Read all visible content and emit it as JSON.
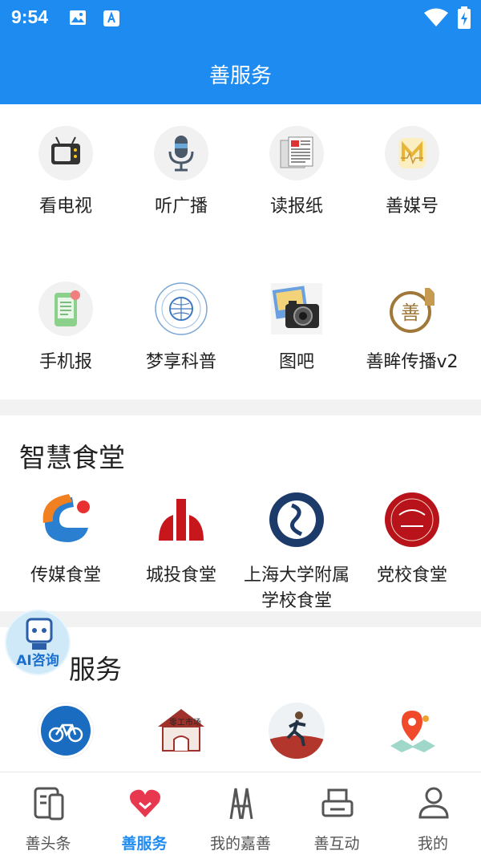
{
  "status": {
    "time": "9:54"
  },
  "header": {
    "title": "善服务"
  },
  "media_grid": [
    {
      "label": "看电视",
      "icon": "tv-icon"
    },
    {
      "label": "听广播",
      "icon": "microphone-icon"
    },
    {
      "label": "读报纸",
      "icon": "newspaper-icon"
    },
    {
      "label": "善媒号",
      "icon": "media-account-icon"
    },
    {
      "label": "手机报",
      "icon": "mobile-news-icon"
    },
    {
      "label": "梦享科普",
      "icon": "science-popularization-icon"
    },
    {
      "label": "图吧",
      "icon": "camera-photo-icon"
    },
    {
      "label": "善眸传播v2",
      "icon": "shanmou-icon"
    }
  ],
  "canteen": {
    "title": "智慧食堂",
    "items": [
      {
        "label": "传媒食堂",
        "icon": "media-canteen-logo"
      },
      {
        "label": "城投食堂",
        "icon": "chengtou-logo"
      },
      {
        "label": "上海大学附属学校食堂",
        "icon": "shu-school-logo"
      },
      {
        "label": "党校食堂",
        "icon": "party-school-logo"
      }
    ]
  },
  "services": {
    "title": "生活服务",
    "items": [
      {
        "icon": "bicycle-icon"
      },
      {
        "icon": "market-icon"
      },
      {
        "icon": "runner-icon"
      },
      {
        "icon": "map-pin-icon"
      }
    ]
  },
  "ai": {
    "label": "AI咨询"
  },
  "tabbar": [
    {
      "label": "善头条",
      "icon": "news-icon",
      "active": false
    },
    {
      "label": "善服务",
      "icon": "heart-icon",
      "active": true
    },
    {
      "label": "我的嘉善",
      "icon": "bridge-icon",
      "active": false
    },
    {
      "label": "善互动",
      "icon": "printer-icon",
      "active": false
    },
    {
      "label": "我的",
      "icon": "user-icon",
      "active": false
    }
  ],
  "colors": {
    "brand": "#1e8bf0",
    "heart": "#e8384f",
    "divider": "#f2f2f2"
  }
}
